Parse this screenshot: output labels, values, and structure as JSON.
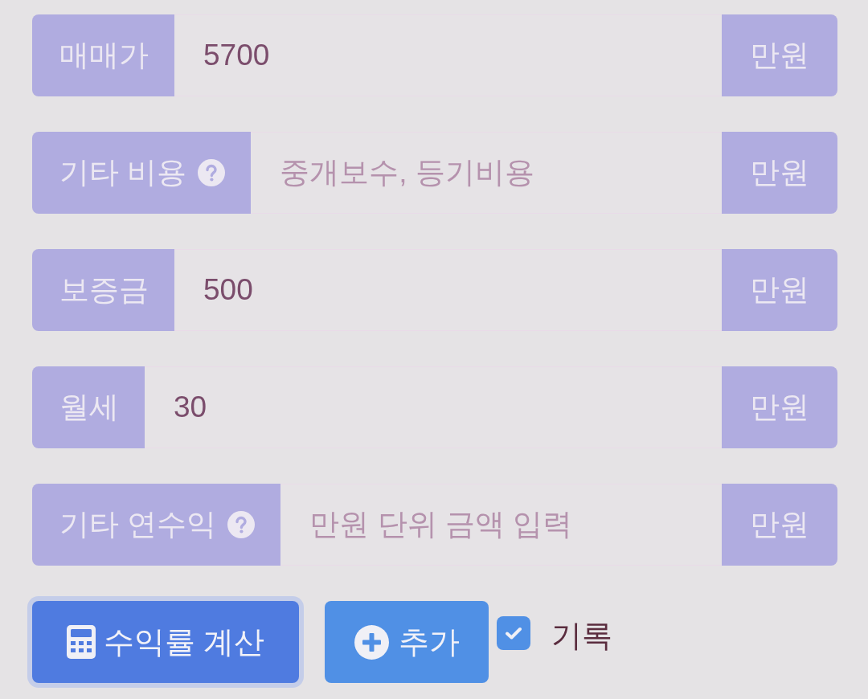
{
  "fields": [
    {
      "label": "매매가",
      "help_icon": false,
      "value": "5700",
      "unit": "만원"
    },
    {
      "label": "기타 비용",
      "help_icon": true,
      "placeholder": "중개보수, 등기비용",
      "unit": "만원"
    },
    {
      "label": "보증금",
      "help_icon": false,
      "value": "500",
      "unit": "만원"
    },
    {
      "label": "월세",
      "help_icon": false,
      "value": "30",
      "unit": "만원"
    },
    {
      "label": "기타 연수익",
      "help_icon": true,
      "placeholder": "만원 단위 금액 입력",
      "unit": "만원"
    }
  ],
  "actions": [
    {
      "kind": "calculate",
      "label": "수익률 계산",
      "focused": true
    },
    {
      "kind": "add",
      "label": "추가",
      "focused": false
    }
  ],
  "record": {
    "label": "기록",
    "checked": true
  }
}
